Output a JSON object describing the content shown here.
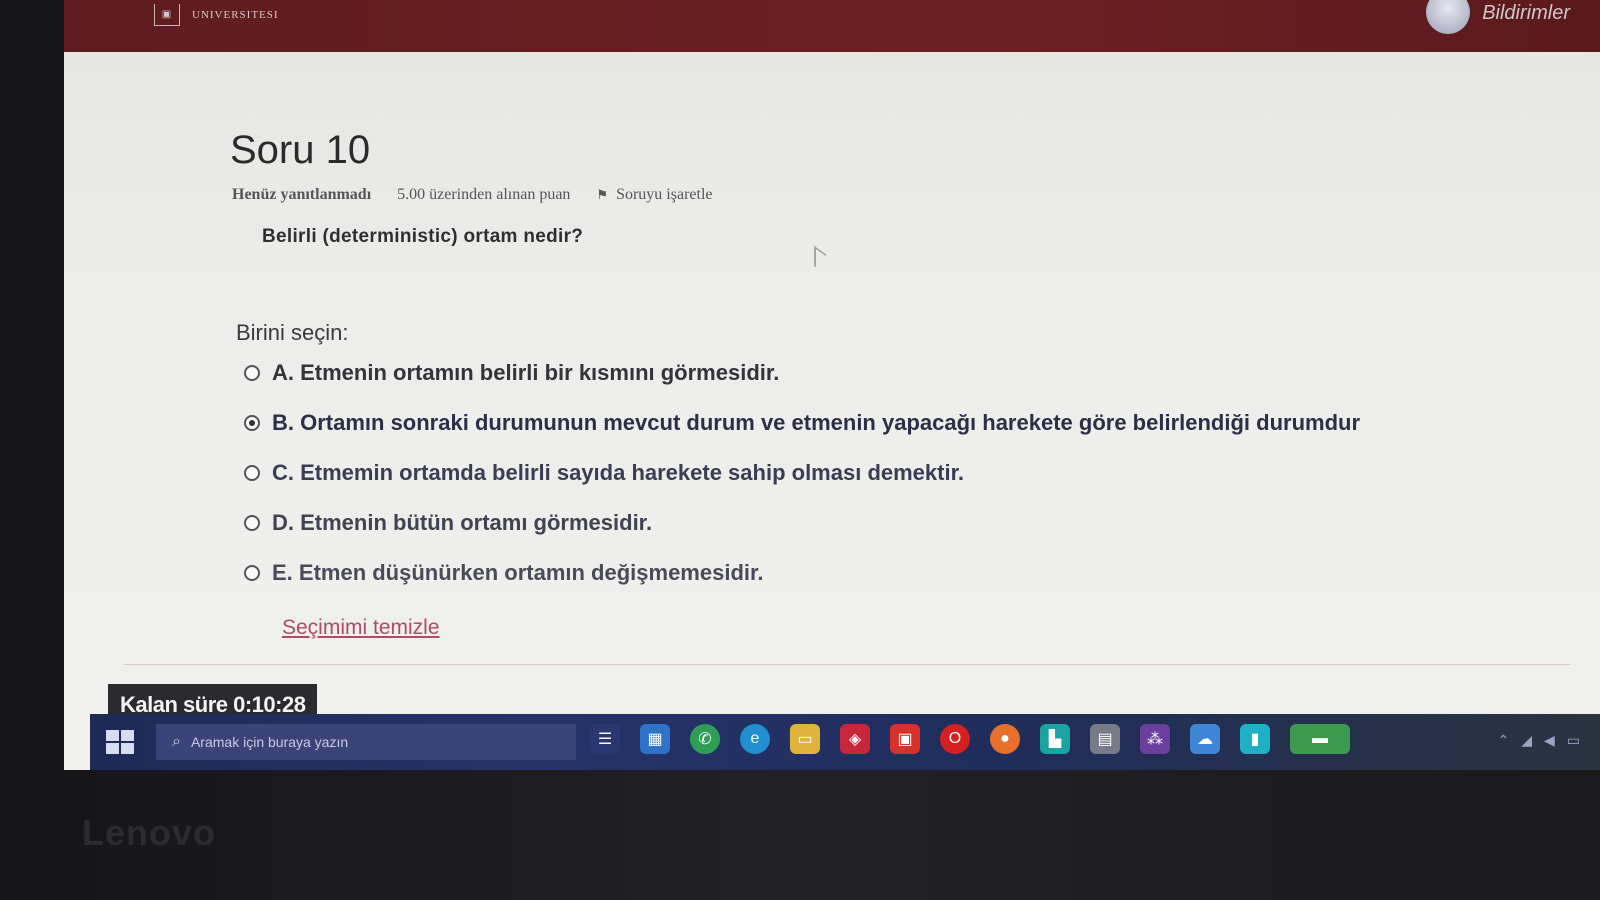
{
  "header": {
    "logo_text": "UNIVERSITESI",
    "user_name": "Bildirimler"
  },
  "question": {
    "title": "Soru 10",
    "status": "Henüz yanıtlanmadı",
    "points": "5.00 üzerinden alınan puan",
    "flag_label": "Soruyu işaretle",
    "text": "Belirli (deterministic) ortam nedir?"
  },
  "choices": {
    "label": "Birini seçin:",
    "options": [
      {
        "text": "A. Etmenin ortamın belirli bir kısmını görmesidir.",
        "selected": false
      },
      {
        "text": "B. Ortamın sonraki durumunun mevcut durum ve etmenin yapacağı harekete göre belirlendiği durumdur",
        "selected": true
      },
      {
        "text": "C. Etmemin ortamda belirli sayıda harekete sahip olması demektir.",
        "selected": false
      },
      {
        "text": "D. Etmenin bütün ortamı görmesidir.",
        "selected": false
      },
      {
        "text": "E. Etmen düşünürken ortamın değişmemesidir.",
        "selected": false
      }
    ],
    "clear_label": "Seçimimi temizle"
  },
  "timer": {
    "text": "Kalan süre 0:10:28"
  },
  "taskbar": {
    "search_placeholder": "Aramak için buraya yazın",
    "icons": [
      "task-view-icon",
      "store-icon",
      "whatsapp-icon",
      "edge-icon",
      "file-explorer-icon",
      "app-red-icon",
      "office-icon",
      "opera-icon",
      "firefox-icon",
      "app-teal-icon",
      "camera-icon",
      "app-purple-icon",
      "weather-icon",
      "app-cyan-icon",
      "app-green-icon"
    ]
  },
  "bezel": {
    "brand": "Lenovo"
  }
}
